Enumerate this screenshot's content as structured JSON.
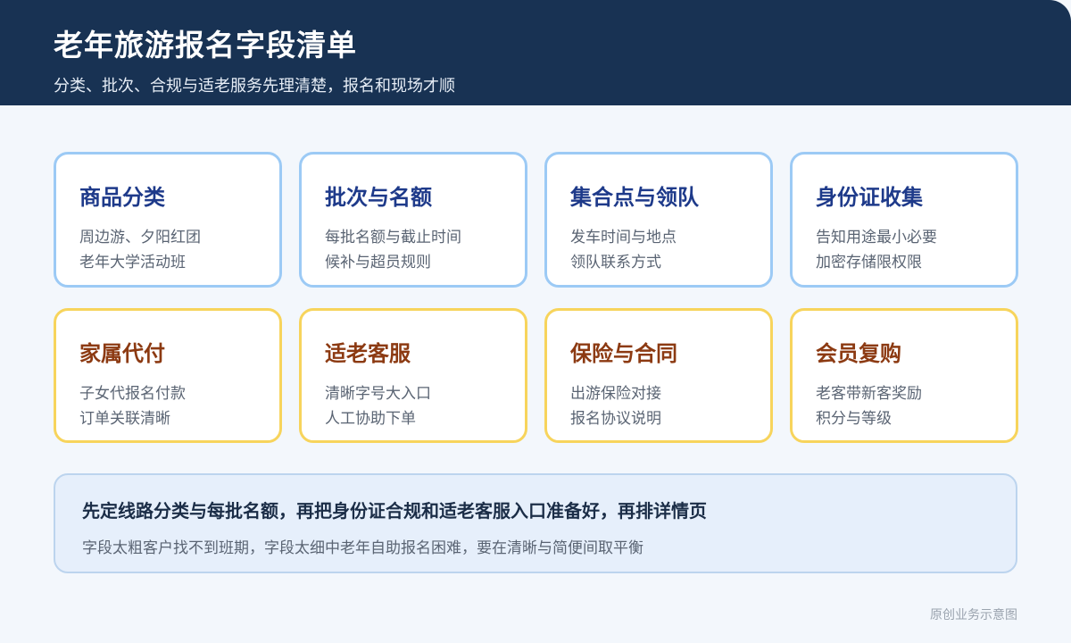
{
  "header": {
    "title": "老年旅游报名字段清单",
    "subtitle": "分类、批次、合规与适老服务先理清楚，报名和现场才顺"
  },
  "cards": [
    {
      "title": "商品分类",
      "lines": [
        "周边游、夕阳红团",
        "老年大学活动班"
      ]
    },
    {
      "title": "批次与名额",
      "lines": [
        "每批名额与截止时间",
        "候补与超员规则"
      ]
    },
    {
      "title": "集合点与领队",
      "lines": [
        "发车时间与地点",
        "领队联系方式"
      ]
    },
    {
      "title": "身份证收集",
      "lines": [
        "告知用途最小必要",
        "加密存储限权限"
      ]
    },
    {
      "title": "家属代付",
      "lines": [
        "子女代报名付款",
        "订单关联清晰"
      ]
    },
    {
      "title": "适老客服",
      "lines": [
        "清晰字号大入口",
        "人工协助下单"
      ]
    },
    {
      "title": "保险与合同",
      "lines": [
        "出游保险对接",
        "报名协议说明"
      ]
    },
    {
      "title": "会员复购",
      "lines": [
        "老客带新客奖励",
        "积分与等级"
      ]
    }
  ],
  "summary": {
    "title": "先定线路分类与每批名额，再把身份证合规和适老客服入口准备好，再排详情页",
    "note": "字段太粗客户找不到班期，字段太细中老年自助报名困难，要在清晰与简便间取平衡"
  },
  "footer": {
    "note": "原创业务示意图"
  },
  "colors": {
    "header_bg": "#183253",
    "cool_border": "#9ccaf5",
    "warm_border": "#f7d45c",
    "cool_title": "#1e3a8a",
    "warm_title": "#8c3a12"
  }
}
